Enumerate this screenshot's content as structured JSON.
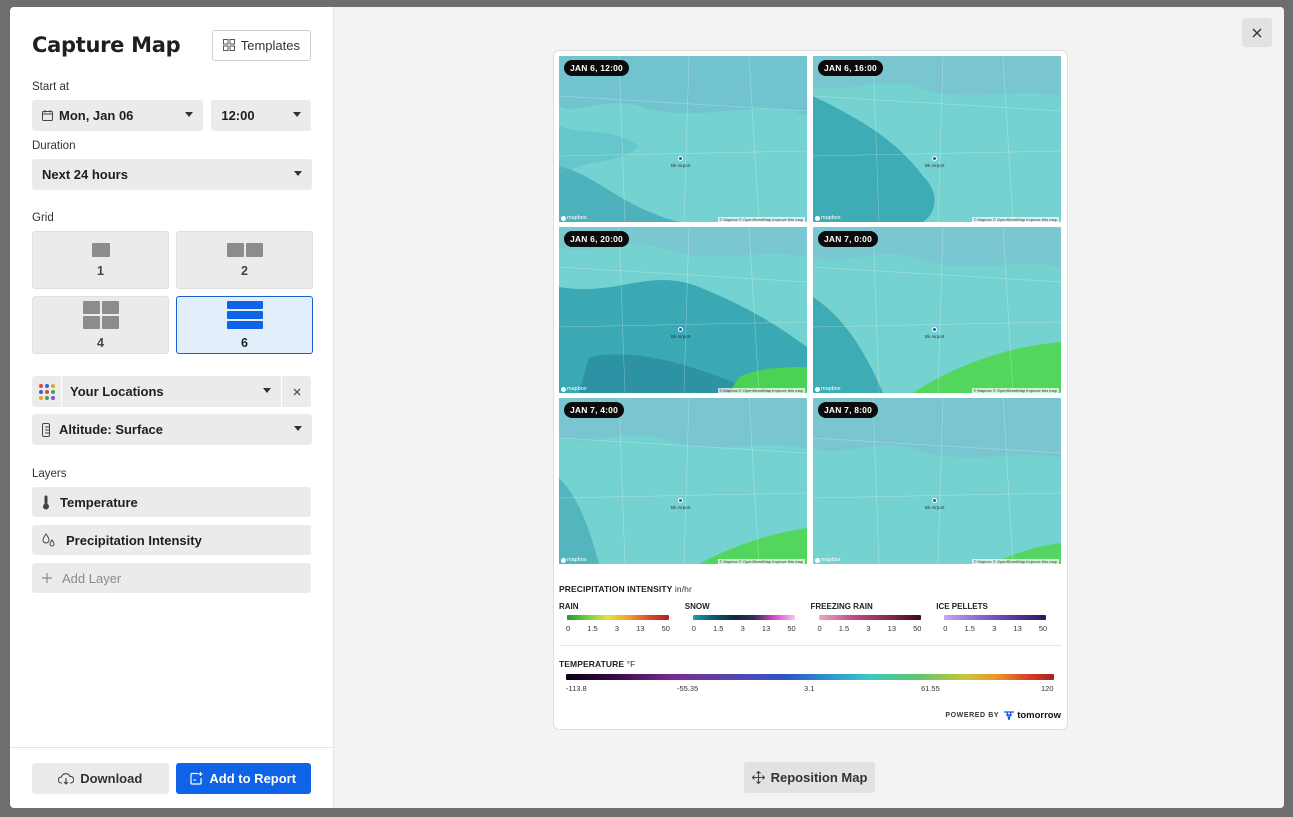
{
  "sidebar": {
    "title": "Capture Map",
    "templates_label": "Templates",
    "start_label": "Start at",
    "start_date": "Mon, Jan 06",
    "start_time": "12:00",
    "duration_label": "Duration",
    "duration_value": "Next 24 hours",
    "grid_label": "Grid",
    "grid_options": [
      "1",
      "2",
      "4",
      "6"
    ],
    "grid_selected": "6",
    "locations_value": "Your Locations",
    "altitude_value": "Altitude: Surface",
    "layers_label": "Layers",
    "layers": [
      "Temperature",
      "Precipitation Intensity"
    ],
    "add_layer_label": "Add Layer",
    "download_label": "Download",
    "add_report_label": "Add to Report"
  },
  "main": {
    "close_label": "×",
    "reposition_label": "Reposition Map",
    "maps": [
      {
        "time": "JAN 6, 12:00",
        "pin_label": "Bk Airport"
      },
      {
        "time": "JAN 6, 16:00",
        "pin_label": "Bk Airport"
      },
      {
        "time": "JAN 6, 20:00",
        "pin_label": "Bk Airport"
      },
      {
        "time": "JAN 7, 0:00",
        "pin_label": "Bk Airport"
      },
      {
        "time": "JAN 7, 4:00",
        "pin_label": "Bk Airport"
      },
      {
        "time": "JAN 7, 8:00",
        "pin_label": "Bk Airport"
      }
    ],
    "mapbox_label": "mapbox",
    "attribution": "© Mapbox © OpenStreetMap Improve this map",
    "legend": {
      "precip_title": "PRECIPITATION INTENSITY",
      "precip_unit": "in/hr",
      "types": [
        {
          "name": "RAIN",
          "ticks": [
            "0",
            "1.5",
            "3",
            "13",
            "50"
          ]
        },
        {
          "name": "SNOW",
          "ticks": [
            "0",
            "1.5",
            "3",
            "13",
            "50"
          ]
        },
        {
          "name": "FREEZING RAIN",
          "ticks": [
            "0",
            "1.5",
            "3",
            "13",
            "50"
          ]
        },
        {
          "name": "ICE PELLETS",
          "ticks": [
            "0",
            "1.5",
            "3",
            "13",
            "50"
          ]
        }
      ],
      "temp_title": "TEMPERATURE",
      "temp_unit": "°F",
      "temp_ticks": [
        "-113.8",
        "-55.35",
        "3.1",
        "61.55",
        "120"
      ]
    },
    "powered_by": "POWERED BY",
    "brand": "tomorrow",
    "colors": {
      "accent": "#0f63e6",
      "map_base": "#6fd3cf",
      "map_dark": "#2c9fab",
      "precip_green": "#4cd64a"
    }
  }
}
